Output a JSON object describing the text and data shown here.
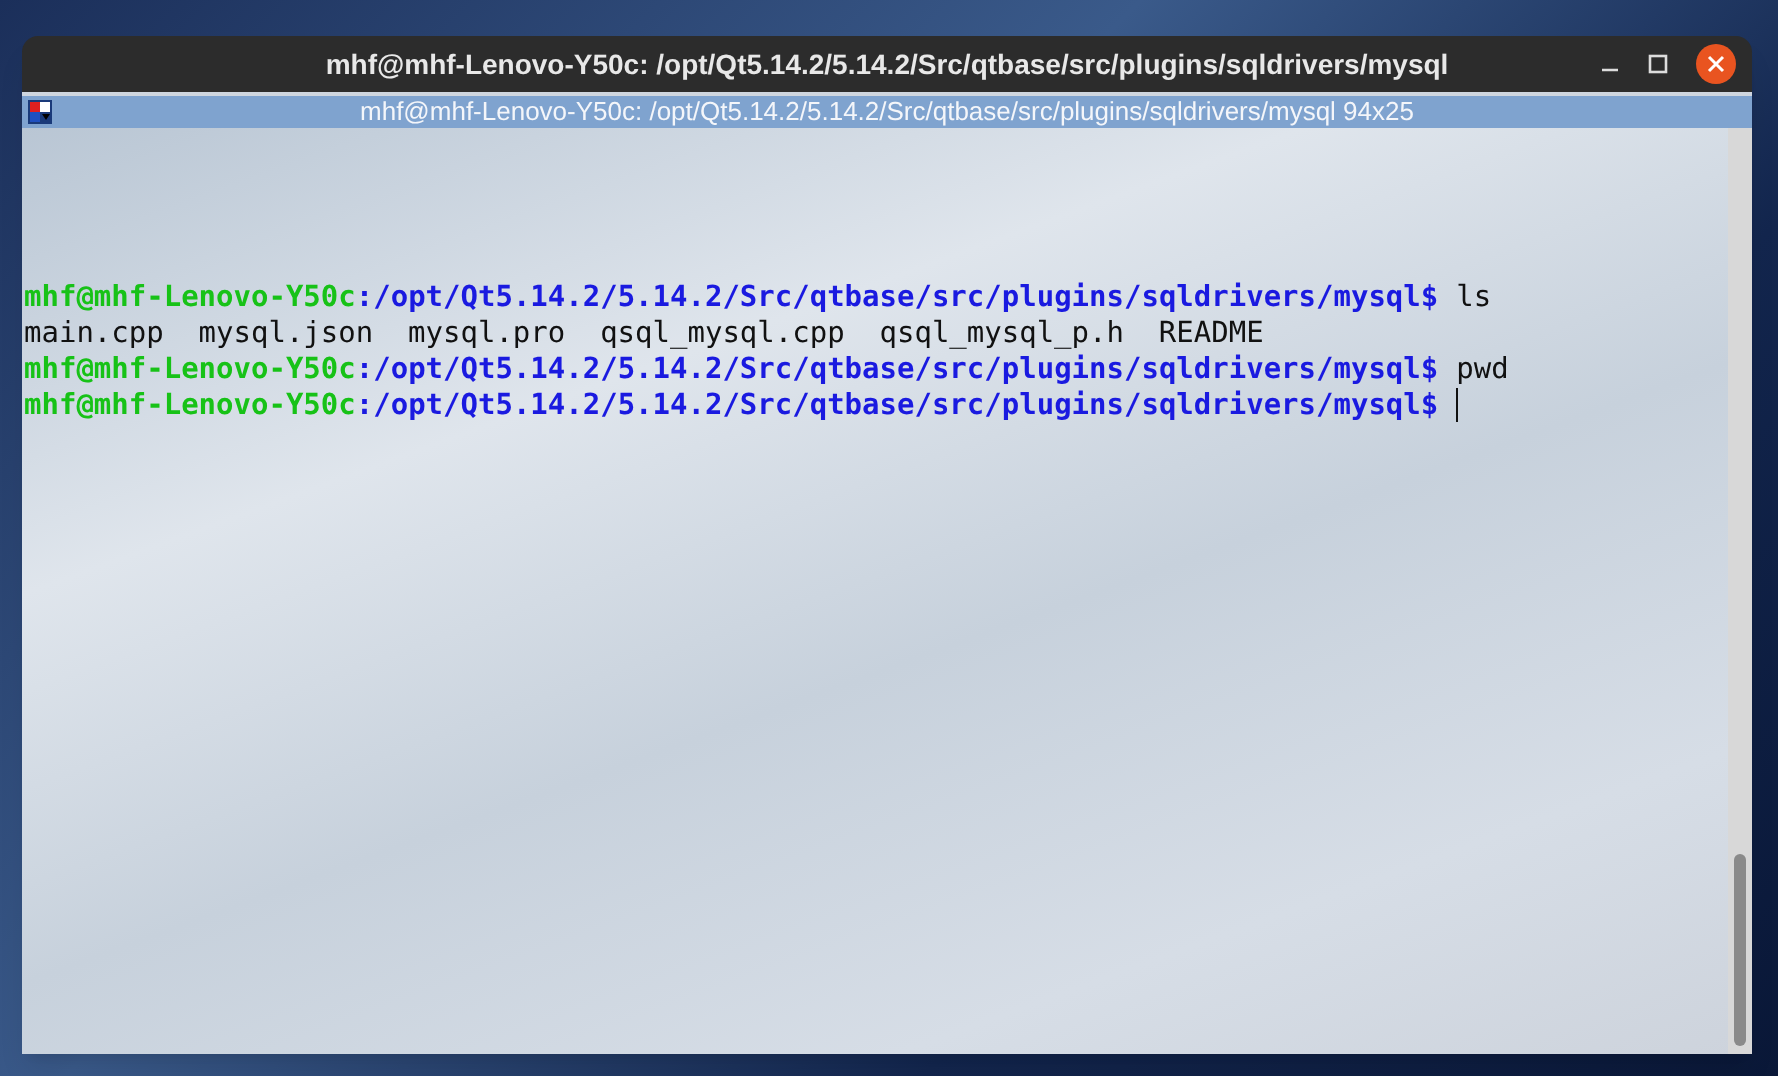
{
  "window": {
    "title": "mhf@mhf-Lenovo-Y50c: /opt/Qt5.14.2/5.14.2/Src/qtbase/src/plugins/sqldrivers/mysql"
  },
  "terminal": {
    "title": "mhf@mhf-Lenovo-Y50c: /opt/Qt5.14.2/5.14.2/Src/qtbase/src/plugins/sqldrivers/mysql 94x25",
    "lines": [
      {
        "kind": "prompt",
        "user": "mhf@mhf-Lenovo-Y50c",
        "path": ":/opt/Qt5.14.2/5.14.2/Src/qtbase/src/plugins/sqldrivers/mysql$",
        "command": "ls",
        "cursor": false
      },
      {
        "kind": "output",
        "text": "main.cpp  mysql.json  mysql.pro  qsql_mysql.cpp  qsql_mysql_p.h  README"
      },
      {
        "kind": "prompt",
        "user": "mhf@mhf-Lenovo-Y50c",
        "path": ":/opt/Qt5.14.2/5.14.2/Src/qtbase/src/plugins/sqldrivers/mysql$",
        "command": "pwd",
        "cursor": false
      },
      {
        "kind": "prompt",
        "user": "mhf@mhf-Lenovo-Y50c",
        "path": ":/opt/Qt5.14.2/5.14.2/Src/qtbase/src/plugins/sqldrivers/mysql$",
        "cursor": true
      }
    ]
  }
}
